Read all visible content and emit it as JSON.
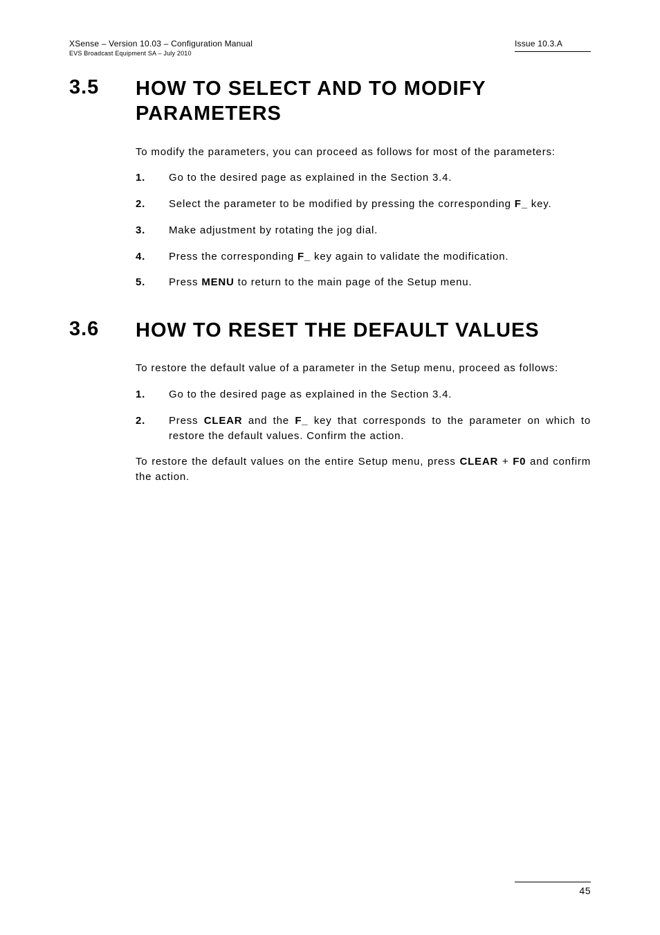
{
  "header": {
    "left_top": "XSense – Version 10.03 – Configuration Manual",
    "left_bottom": "EVS Broadcast Equipment SA – July  2010",
    "right": "Issue 10.3.A"
  },
  "section35": {
    "num": "3.5",
    "title": "HOW TO SELECT AND TO MODIFY PARAMETERS",
    "intro": "To modify the parameters, you can proceed as follows for most of the parameters:",
    "items": {
      "n1": "1.",
      "t1": "Go to the desired page as explained in the Section 3.4.",
      "n2": "2.",
      "t2a": "Select the parameter to be modified by pressing the corresponding ",
      "t2b": "F_",
      "t2c": " key.",
      "n3": "3.",
      "t3": "Make adjustment by rotating the jog dial.",
      "n4": "4.",
      "t4a": "Press the corresponding ",
      "t4b": "F_",
      "t4c": " key again to validate the modification.",
      "n5": "5.",
      "t5a": "Press ",
      "t5b": "MENU",
      "t5c": " to return to the main page of the Setup menu."
    }
  },
  "section36": {
    "num": "3.6",
    "title": "HOW TO RESET THE DEFAULT VALUES",
    "intro": "To restore the default value of a parameter in the Setup menu, proceed as follows:",
    "items": {
      "n1": "1.",
      "t1": "Go to the desired page as explained in the Section 3.4.",
      "n2": "2.",
      "t2a": "Press ",
      "t2b": "CLEAR",
      "t2c": " and the ",
      "t2d": "F_",
      "t2e": " key that corresponds to the parameter on which to restore the default values. Confirm the action."
    },
    "outro_a": "To restore the default values on the entire Setup menu, press ",
    "outro_b": "CLEAR",
    "outro_c": " + ",
    "outro_d": "F0",
    "outro_e": " and confirm the action."
  },
  "footer": {
    "page": "45"
  }
}
